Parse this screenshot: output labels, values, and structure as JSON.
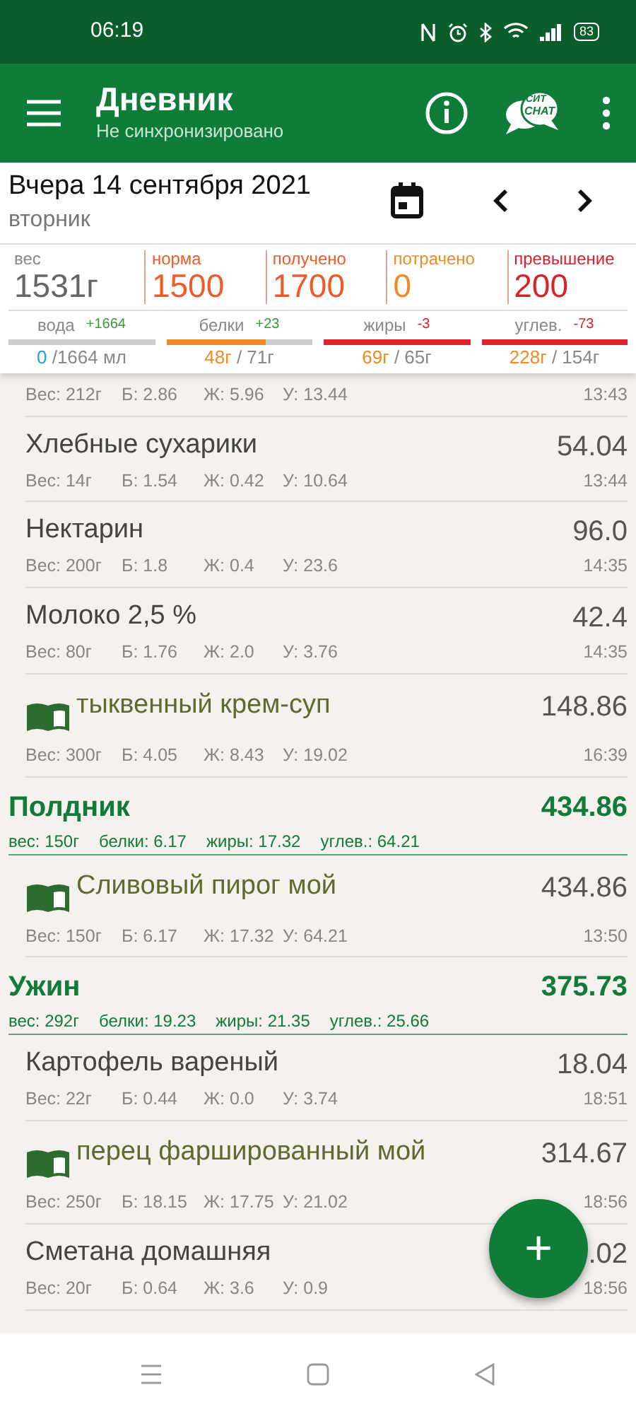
{
  "status_bar": {
    "time": "06:19",
    "battery": "83"
  },
  "toolbar": {
    "title": "Дневник",
    "subtitle": "Не синхронизировано",
    "chat_badge_top": "СИТ",
    "chat_badge_bottom": "CHAT"
  },
  "date": {
    "title": "Вчера 14 сентября 2021",
    "weekday": "вторник"
  },
  "summary": [
    {
      "label": "вес",
      "value": "1531г",
      "color": "#666666"
    },
    {
      "label": "норма",
      "value": "1500",
      "color": "#ee5a2a"
    },
    {
      "label": "получено",
      "value": "1700",
      "color": "#ee5a2a"
    },
    {
      "label": "потрачено",
      "value": "0",
      "color": "#f08a24"
    },
    {
      "label": "превышение",
      "value": "200",
      "color": "#d9212c"
    }
  ],
  "macros": [
    {
      "label": "вода",
      "delta": "+1664",
      "over": false,
      "consumed": "0",
      "total": " /1664 мл",
      "kind": "water"
    },
    {
      "label": "белки",
      "delta": "+23",
      "over": false,
      "level": 0.68,
      "consumed": "48г",
      "total": " / 71г",
      "kind": "nutrient"
    },
    {
      "label": "жиры",
      "delta": "-3",
      "over": true,
      "level": 1,
      "consumed": "69г",
      "total": " / 65г",
      "kind": "nutrient"
    },
    {
      "label": "углев.",
      "delta": "-73",
      "over": true,
      "level": 1,
      "consumed": "228г",
      "total": " / 154г",
      "kind": "nutrient"
    }
  ],
  "entries": [
    {
      "kind": "partial",
      "weight": "Вес: 212г",
      "protein": "Б: 2.86",
      "fat": "Ж: 5.96",
      "carbs": "У: 13.44",
      "time": "13:43"
    },
    {
      "kind": "food",
      "name": "Хлебные сухарики",
      "kcal": "54.04",
      "weight": "Вес: 14г",
      "protein": "Б: 1.54",
      "fat": "Ж: 0.42",
      "carbs": "У: 10.64",
      "time": "13:44"
    },
    {
      "kind": "food",
      "name": "Нектарин",
      "kcal": "96.0",
      "weight": "Вес: 200г",
      "protein": "Б: 1.8",
      "fat": "Ж: 0.4",
      "carbs": "У: 23.6",
      "time": "14:35"
    },
    {
      "kind": "food",
      "name": "Молоко 2,5 %",
      "kcal": "42.4",
      "weight": "Вес: 80г",
      "protein": "Б: 1.76",
      "fat": "Ж: 2.0",
      "carbs": "У: 3.76",
      "time": "14:35"
    },
    {
      "kind": "recipe",
      "name": "тыквенный крем-суп",
      "kcal": "148.86",
      "weight": "Вес: 300г",
      "protein": "Б: 4.05",
      "fat": "Ж: 8.43",
      "carbs": "У: 19.02",
      "time": "16:39"
    },
    {
      "kind": "meal",
      "name": "Полдник",
      "kcal": "434.86",
      "weight": "вес: 150г",
      "protein": "белки: 6.17",
      "fat": "жиры: 17.32",
      "carbs": "углев.: 64.21"
    },
    {
      "kind": "recipe",
      "name": "Сливовый пирог мой",
      "kcal": "434.86",
      "weight": "Вес: 150г",
      "protein": "Б: 6.17",
      "fat": "Ж: 17.32",
      "carbs": "У: 64.21",
      "time": "13:50"
    },
    {
      "kind": "meal",
      "name": "Ужин",
      "kcal": "375.73",
      "weight": "вес: 292г",
      "protein": "белки: 19.23",
      "fat": "жиры: 21.35",
      "carbs": "углев.: 25.66"
    },
    {
      "kind": "food",
      "name": "Картофель вареный",
      "kcal": "18.04",
      "weight": "Вес: 22г",
      "protein": "Б: 0.44",
      "fat": "Ж: 0.0",
      "carbs": "У: 3.74",
      "time": "18:51"
    },
    {
      "kind": "recipe",
      "name": "перец фаршированный мой",
      "kcal": "314.67",
      "weight": "Вес: 250г",
      "protein": "Б: 18.15",
      "fat": "Ж: 17.75",
      "carbs": "У: 21.02",
      "time": "18:56"
    },
    {
      "kind": "food",
      "name": "Сметана домашняя",
      "kcal": ".02",
      "weight": "Вес: 20г",
      "protein": "Б: 0.64",
      "fat": "Ж: 3.6",
      "carbs": "У: 0.9",
      "time": "18:56"
    }
  ],
  "fab": {
    "label": "+"
  }
}
